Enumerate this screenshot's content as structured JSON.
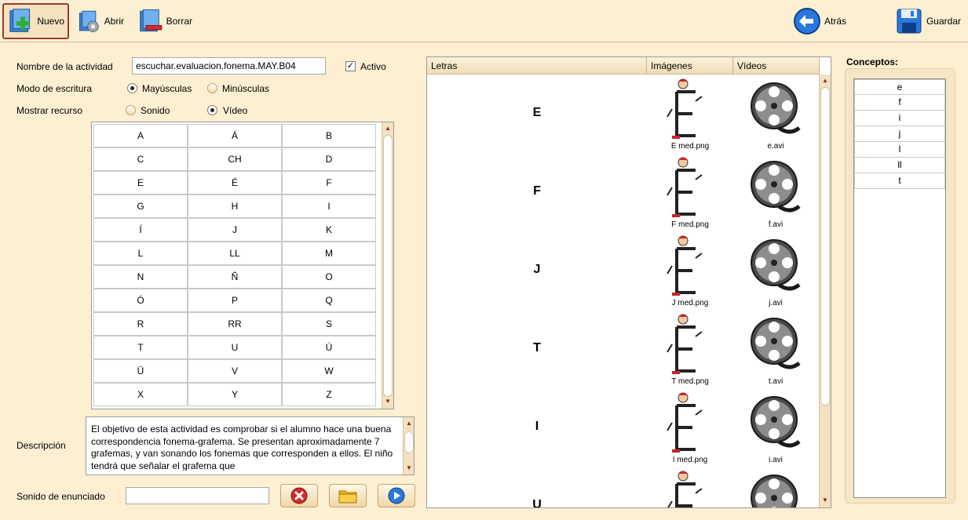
{
  "toolbar": {
    "nuevo": "Nuevo",
    "abrir": "Abrir",
    "borrar": "Borrar",
    "atras": "Atrás",
    "guardar": "Guardar"
  },
  "form": {
    "activity_name_label": "Nombre de la actividad",
    "activity_name_value": "escuchar.evaluacion.fonema.MAY.B04",
    "active_label": "Activo",
    "active_checked": true,
    "writing_mode_label": "Modo de escritura",
    "uppercase_label": "Mayúsculas",
    "lowercase_label": "Minúsculas",
    "writing_mode_selected": "uppercase",
    "show_resource_label": "Mostrar recurso",
    "sound_label": "Sonido",
    "video_label": "Vídeo",
    "show_resource_selected": "video",
    "description_label": "Descripción",
    "description_text": "El objetivo de esta actividad es comprobar si el alumno hace una buena correspondencia fonema-grafema. Se presentan aproximadamente 7 grafemas, y van sonando los fonemas que corresponden a ellos. El niño tendrá que señalar el grafema que",
    "statement_sound_label": "Sonido de enunciado",
    "statement_sound_value": ""
  },
  "letters": [
    "A",
    "Á",
    "B",
    "C",
    "CH",
    "D",
    "E",
    "É",
    "F",
    "G",
    "H",
    "I",
    "Í",
    "J",
    "K",
    "L",
    "LL",
    "M",
    "N",
    "Ñ",
    "O",
    "Ó",
    "P",
    "Q",
    "R",
    "RR",
    "S",
    "T",
    "U",
    "Ú",
    "Ü",
    "V",
    "W",
    "X",
    "Y",
    "Z"
  ],
  "resources": {
    "headers": {
      "letters": "Letras",
      "images": "Imágenes",
      "videos": "Vídeos"
    },
    "rows": [
      {
        "letter": "E",
        "image": "E med.png",
        "video": "e.avi"
      },
      {
        "letter": "F",
        "image": "F med.png",
        "video": "f.avi"
      },
      {
        "letter": "J",
        "image": "J med.png",
        "video": "j.avi"
      },
      {
        "letter": "T",
        "image": "T med.png",
        "video": "t.avi"
      },
      {
        "letter": "I",
        "image": "I med.png",
        "video": "i.avi"
      },
      {
        "letter": "U",
        "image": "",
        "video": ""
      }
    ]
  },
  "concepts": {
    "title": "Conceptos:",
    "items": [
      "e",
      "f",
      "i",
      "j",
      "l",
      "ll",
      "t"
    ]
  },
  "colors": {
    "background": "#fcefd2",
    "accent_red": "#9b3a2c",
    "nav_blue": "#1f6fd6"
  }
}
